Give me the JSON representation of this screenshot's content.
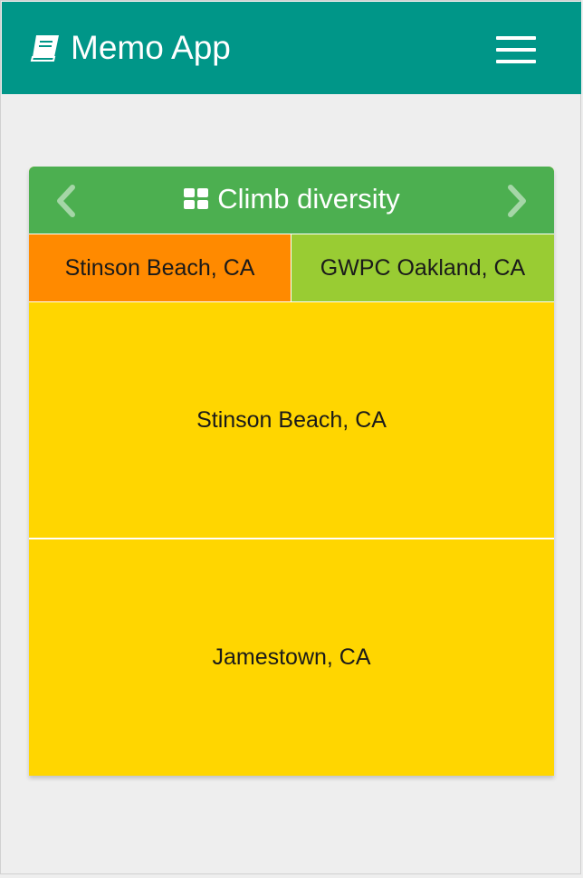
{
  "app_bar": {
    "title": "Memo App",
    "title_icon": "book-icon",
    "menu_icon": "hamburger-menu-icon",
    "color": "#009688"
  },
  "card": {
    "header": {
      "title": "Climb diversity",
      "title_icon": "grid-icon",
      "prev_icon": "chevron-left-icon",
      "next_icon": "chevron-right-icon",
      "color": "#4caf50"
    },
    "tabs": [
      {
        "label": "Stinson Beach, CA",
        "color": "#ff8a00"
      },
      {
        "label": "GWPC Oakland, CA",
        "color": "#99cc33"
      }
    ],
    "tiles": [
      {
        "label": "Stinson Beach, CA",
        "color": "#ffd600"
      },
      {
        "label": "Jamestown, CA",
        "color": "#ffd600"
      }
    ]
  }
}
